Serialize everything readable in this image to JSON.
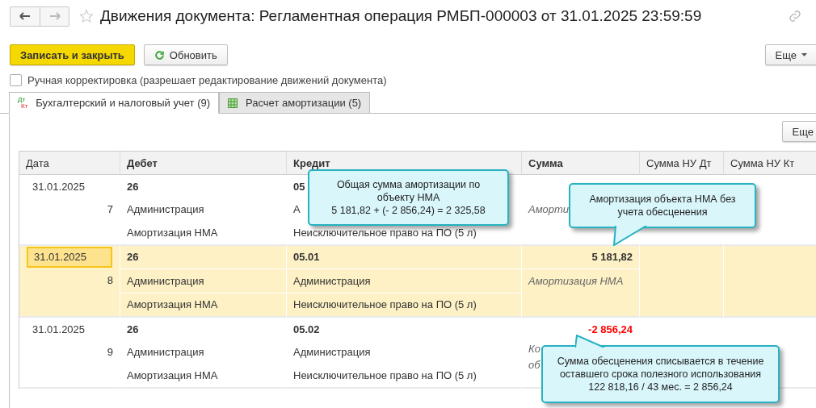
{
  "window": {
    "title": "Движения документа: Регламентная операция РМБП-000003 от 31.01.2025 23:59:59",
    "favorite": false
  },
  "toolbar": {
    "primary": "Записать и закрыть",
    "refresh": "Обновить",
    "more": "Еще"
  },
  "manual_edit": {
    "label": "Ручная корректировка (разрешает редактирование движений документа)",
    "checked": false
  },
  "tabs": [
    {
      "label": "Бухгалтерский и налоговый учет (9)",
      "kind": "dtkt",
      "badge": [
        "Дт",
        "Кт"
      ],
      "selected": true
    },
    {
      "label": "Расчет амортизации (5)",
      "kind": "grid",
      "selected": false
    }
  ],
  "table_more": "Еще",
  "table": {
    "columns": [
      {
        "label": "Дата",
        "bold": false
      },
      {
        "label": "Дебет",
        "bold": true
      },
      {
        "label": "Кредит",
        "bold": true
      },
      {
        "label": "Сумма",
        "bold": true
      },
      {
        "label": "Сумма НУ Дт",
        "bold": false
      },
      {
        "label": "Сумма НУ Кт",
        "bold": false
      }
    ],
    "rows": [
      {
        "date": "31.01.2025",
        "number": "7",
        "debit": [
          "26",
          "Администрация",
          "Амортизация НМА"
        ],
        "credit": [
          "05",
          "А",
          "Неисключительное право на ПО (5 л)"
        ],
        "content": [
          "Аморти"
        ],
        "selected": false
      },
      {
        "date": "31.01.2025",
        "number": "8",
        "debit": [
          "26",
          "Администрация",
          "Амортизация НМА"
        ],
        "credit": [
          "05.01",
          "Администрация",
          "Неисключительное право на ПО (5 л)"
        ],
        "amount": "5 181,82",
        "negative": false,
        "content": [
          "Амортизация НМА"
        ],
        "selected": true
      },
      {
        "date": "31.01.2025",
        "number": "9",
        "debit": [
          "26",
          "Администрация",
          "Амортизация НМА"
        ],
        "credit": [
          "05.02",
          "Администрация",
          "Неисключительное право на ПО (5 л)"
        ],
        "amount": "-2 856,24",
        "negative": true,
        "content": [
          "Ко",
          "об"
        ],
        "selected": false
      }
    ]
  },
  "callouts": [
    {
      "lines": [
        "Общая сумма амортизации по",
        "объекту НМА",
        "5 181,82 + (- 2 856,24) = 2 325,58"
      ],
      "kind": "plain"
    },
    {
      "lines": [
        "Амортизация объекта НМА без",
        "учета обесценения"
      ],
      "kind": "tail-down"
    },
    {
      "lines": [
        "Сумма обесценения списывается в течение",
        "оставшего срока полезного использования",
        "122 818,16 / 43 мес. = 2 856,24"
      ],
      "kind": "tail-up"
    }
  ]
}
